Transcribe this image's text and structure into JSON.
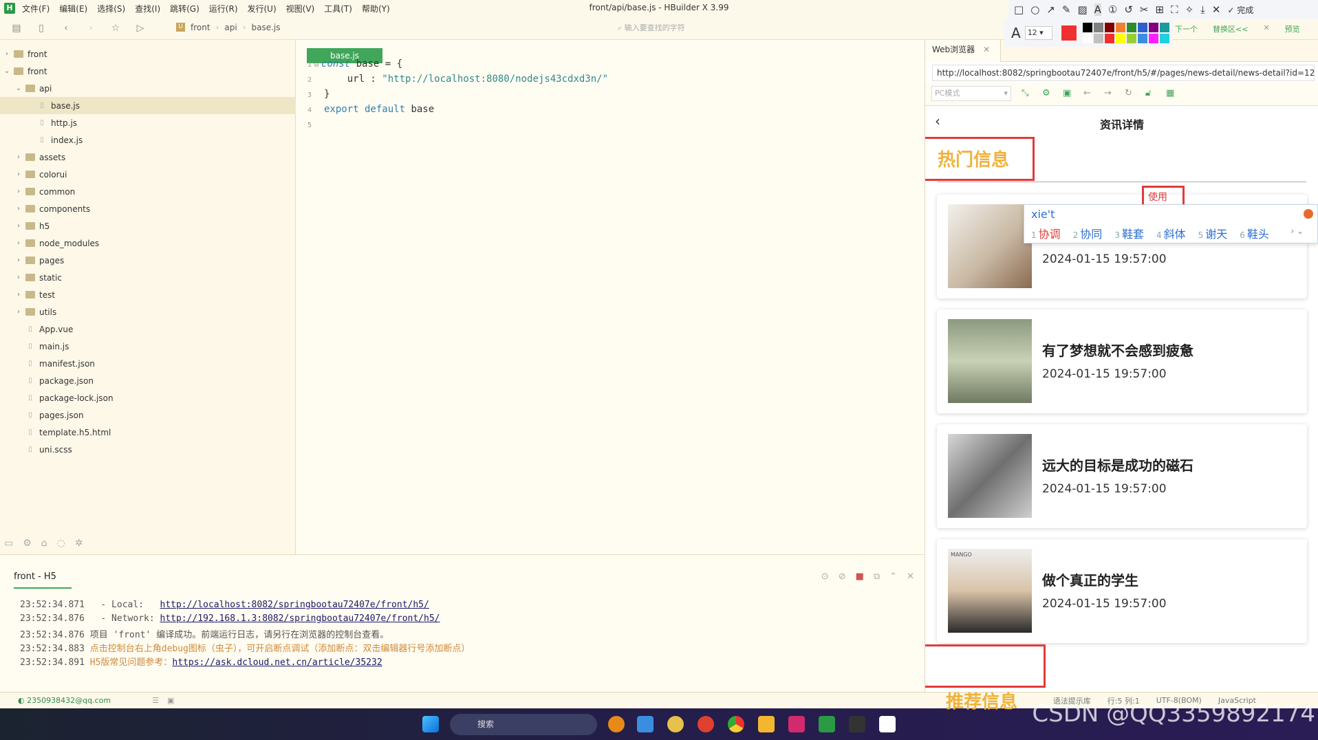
{
  "window": {
    "title": "front/api/base.js - HBuilder X 3.99",
    "logo": "H"
  },
  "menu": [
    "文件(F)",
    "编辑(E)",
    "选择(S)",
    "查找(I)",
    "跳转(G)",
    "运行(R)",
    "发行(U)",
    "视图(V)",
    "工具(T)",
    "帮助(Y)"
  ],
  "toolbar": {
    "breadcrumb": [
      "front",
      "api",
      "base.js"
    ],
    "search_placeholder": "输入要查找的字符"
  },
  "explorer": [
    {
      "label": "front",
      "depth": 0,
      "type": "folder",
      "expanded": false
    },
    {
      "label": "front",
      "depth": 0,
      "type": "project",
      "expanded": true
    },
    {
      "label": "api",
      "depth": 1,
      "type": "folder",
      "expanded": true
    },
    {
      "label": "base.js",
      "depth": 2,
      "type": "file",
      "selected": true
    },
    {
      "label": "http.js",
      "depth": 2,
      "type": "file"
    },
    {
      "label": "index.js",
      "depth": 2,
      "type": "file"
    },
    {
      "label": "assets",
      "depth": 1,
      "type": "folder",
      "expanded": false
    },
    {
      "label": "colorui",
      "depth": 1,
      "type": "folder",
      "expanded": false
    },
    {
      "label": "common",
      "depth": 1,
      "type": "folder",
      "expanded": false
    },
    {
      "label": "components",
      "depth": 1,
      "type": "folder",
      "expanded": false
    },
    {
      "label": "h5",
      "depth": 1,
      "type": "folder",
      "expanded": false
    },
    {
      "label": "node_modules",
      "depth": 1,
      "type": "folder",
      "expanded": false
    },
    {
      "label": "pages",
      "depth": 1,
      "type": "folder",
      "expanded": false
    },
    {
      "label": "static",
      "depth": 1,
      "type": "folder",
      "expanded": false
    },
    {
      "label": "test",
      "depth": 1,
      "type": "folder",
      "expanded": false
    },
    {
      "label": "utils",
      "depth": 1,
      "type": "folder",
      "expanded": false
    },
    {
      "label": "App.vue",
      "depth": 1,
      "type": "file"
    },
    {
      "label": "main.js",
      "depth": 1,
      "type": "file"
    },
    {
      "label": "manifest.json",
      "depth": 1,
      "type": "file"
    },
    {
      "label": "package.json",
      "depth": 1,
      "type": "file"
    },
    {
      "label": "package-lock.json",
      "depth": 1,
      "type": "file"
    },
    {
      "label": "pages.json",
      "depth": 1,
      "type": "file"
    },
    {
      "label": "template.h5.html",
      "depth": 1,
      "type": "file"
    },
    {
      "label": "uni.scss",
      "depth": 1,
      "type": "file"
    }
  ],
  "editor": {
    "tab": "base.js",
    "lines": [
      {
        "n": "1",
        "parts": [
          [
            "kw",
            "const"
          ],
          [
            "",
            "base = {"
          ]
        ]
      },
      {
        "n": "2",
        "parts": [
          [
            "",
            "    url : "
          ],
          [
            "st",
            "\"http://localhost:8080/nodejs43cdxd3n/\""
          ]
        ]
      },
      {
        "n": "3",
        "parts": [
          [
            "",
            "}"
          ]
        ]
      },
      {
        "n": "4",
        "parts": [
          [
            "kw2",
            "export default"
          ],
          [
            "",
            " base"
          ]
        ]
      },
      {
        "n": "5",
        "parts": []
      }
    ]
  },
  "console": {
    "tab": "front - H5",
    "logs": [
      {
        "time": "23:52:34.871",
        "text": "  - Local:   ",
        "link": "http://localhost:8082/springbootau72407e/front/h5/",
        "style": ""
      },
      {
        "time": "23:52:34.876",
        "text": "  - Network: ",
        "link": "http://192.168.1.3:8082/springbootau72407e/front/h5/",
        "style": ""
      },
      {
        "time": "23:52:34.876",
        "text": "项目 'front' 编译成功。前端运行日志，请另行在浏览器的控制台查看。",
        "link": "",
        "style": ""
      },
      {
        "time": "23:52:34.883",
        "text": "点击控制台右上角debug图标（虫子），可开启断点调试（添加断点：双击编辑器行号添加断点）",
        "link": "",
        "style": "orange"
      },
      {
        "time": "23:52:34.891",
        "text": "H5版常见问题参考：",
        "link": "https://ask.dcloud.net.cn/article/35232",
        "style": "orange"
      }
    ]
  },
  "status": {
    "user": "2350938432@qq.com",
    "hint": "语法提示库",
    "position": "行:5  列:1",
    "encoding": "UTF-8(BOM)",
    "language": "JavaScript"
  },
  "browser": {
    "tab": "Web浏览器",
    "url": "http://localhost:8082/springbootau72407e/front/h5/#/pages/news-detail/news-detail?id=120",
    "mode": "PC模式",
    "page": {
      "title": "资讯详情",
      "hot_section": "热门信息",
      "recommend_section": "推荐信息",
      "annotation": "使用",
      "cards": [
        {
          "title": "",
          "date": "2024-01-15 19:57:00",
          "image": "shoes"
        },
        {
          "title": "有了梦想就不会感到疲惫",
          "date": "2024-01-15 19:57:00",
          "image": "dress"
        },
        {
          "title": "远大的目标是成功的磁石",
          "date": "2024-01-15 19:57:00",
          "image": "phones"
        },
        {
          "title": "做个真正的学生",
          "date": "2024-01-15 19:57:00",
          "image": "fashion",
          "image_text": "MANGO"
        }
      ]
    }
  },
  "screenshot_tool": {
    "done": "完成",
    "font_size": "12",
    "font_icon": "A",
    "find_next": "下一个",
    "replace": "替换区<<",
    "preview": "预览",
    "colors": [
      "#000000",
      "#808080",
      "#800000",
      "#f08030",
      "#2e8b2e",
      "#2e5fd0",
      "#800080",
      "#1a9a9a",
      "#ffffff",
      "#c0c0c0",
      "#f03030",
      "#ffff00",
      "#9acd32",
      "#3a8ee0",
      "#ff20ff",
      "#20d0e0"
    ],
    "current_color": "#f03030"
  },
  "ime": {
    "input": "xie't",
    "candidates": [
      "协调",
      "协同",
      "鞋套",
      "斜体",
      "谢天",
      "鞋头"
    ]
  },
  "taskbar": {
    "search": "搜索"
  },
  "watermark": "CSDN @QQ3359892174"
}
